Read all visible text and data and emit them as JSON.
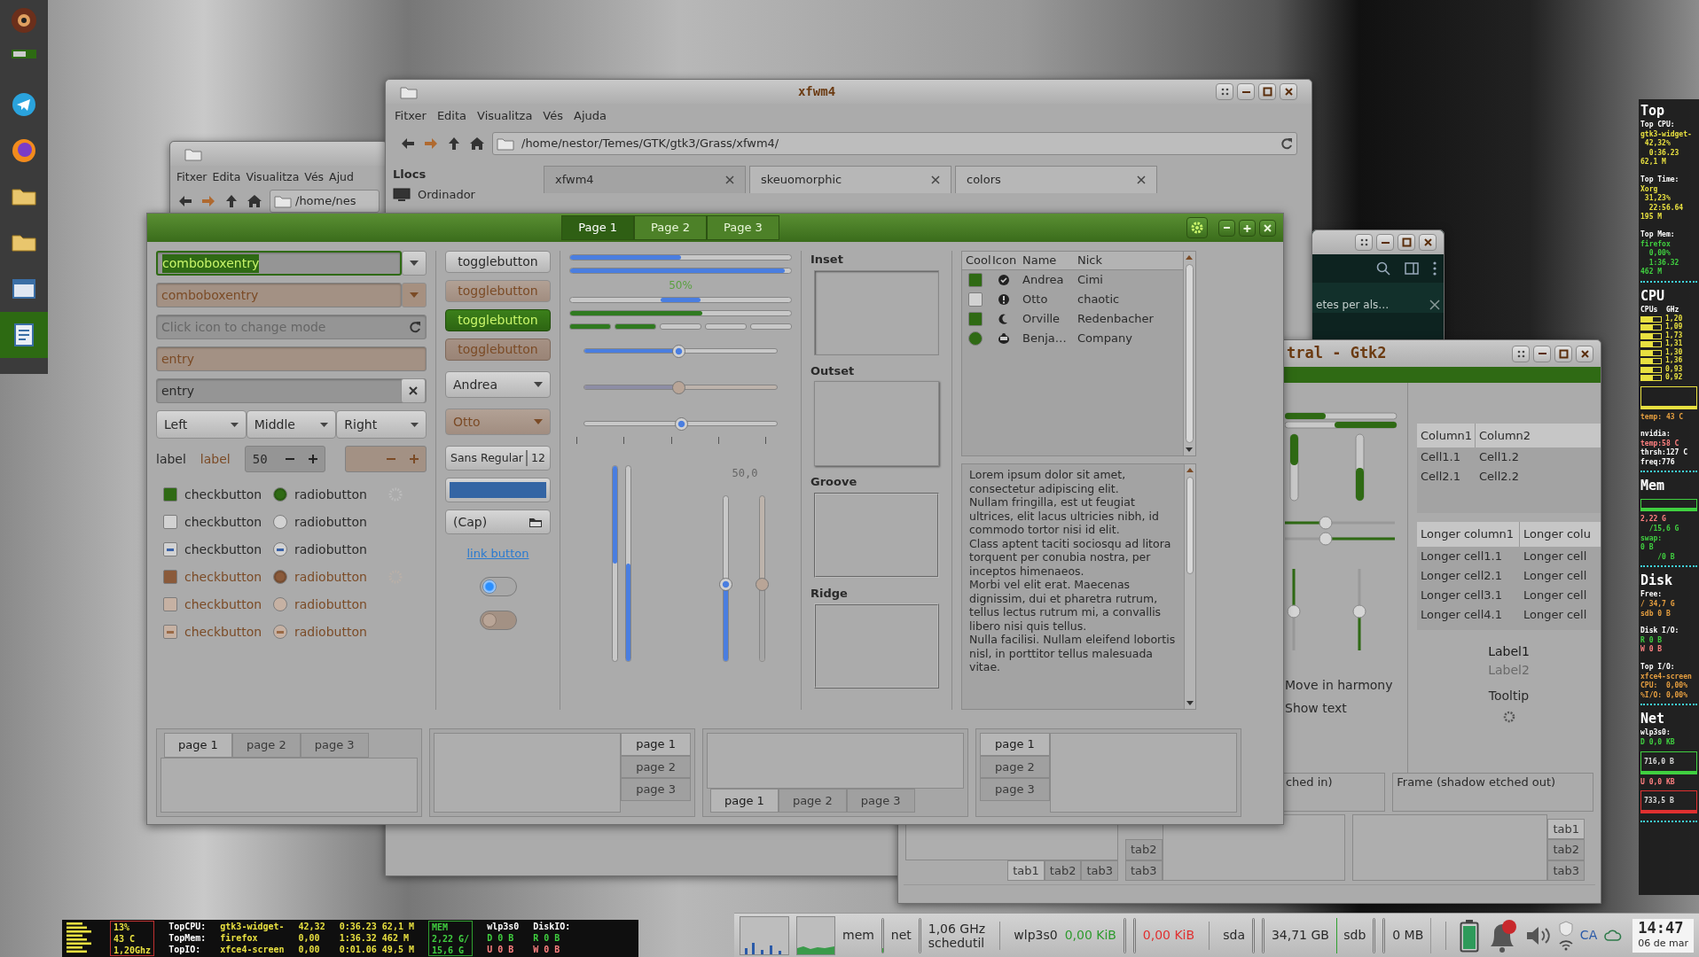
{
  "dock": {
    "items": [
      {
        "selected": false
      },
      {
        "selected": false
      },
      {
        "selected": false
      },
      {
        "selected": false
      },
      {
        "selected": false
      },
      {
        "selected": true
      }
    ]
  },
  "file_manager_back": {
    "menu": [
      "Fitxer",
      "Edita",
      "Visualitza",
      "Vés",
      "Ajud"
    ],
    "path": "/home/nes"
  },
  "file_manager": {
    "title": "xfwm4",
    "menu": [
      "Fitxer",
      "Edita",
      "Visualitza",
      "Vés",
      "Ajuda"
    ],
    "path": "/home/nestor/Temes/GTK/gtk3/Grass/xfwm4/",
    "sidebar": {
      "heading": "Llocs",
      "items": [
        "Ordinador"
      ]
    },
    "tabs": [
      {
        "label": "xfwm4",
        "selected": true
      },
      {
        "label": "skeuomorphic",
        "selected": false
      },
      {
        "label": "colors",
        "selected": false
      }
    ]
  },
  "dark_window": {
    "text": "etes per als…"
  },
  "gtk2_window": {
    "title": "tral - Gtk2",
    "options": [
      "Move in harmony",
      "Show text"
    ],
    "table1": {
      "columns": [
        "Column1",
        "Column2"
      ],
      "rows": [
        [
          "Cell1.1",
          "Cell1.2"
        ],
        [
          "Cell2.1",
          "Cell2.2"
        ]
      ]
    },
    "table2": {
      "columns": [
        "Longer column1",
        "Longer colu"
      ],
      "rows": [
        [
          "Longer cell1.1",
          "Longer cell"
        ],
        [
          "Longer cell2.1",
          "Longer cell"
        ],
        [
          "Longer cell3.1",
          "Longer cell"
        ],
        [
          "Longer cell4.1",
          "Longer cell"
        ]
      ]
    },
    "labels": [
      {
        "text": "Label1",
        "disabled": false
      },
      {
        "text": "Label2",
        "disabled": true
      }
    ],
    "tooltip": "Tooltip",
    "frames": [
      "ched in)",
      "Frame (shadow etched out)"
    ],
    "notebooks": [
      {
        "kind": "bottom",
        "tabs": [
          {
            "label": "tab1",
            "selected": true
          },
          {
            "label": "tab2",
            "selected": false
          },
          {
            "label": "tab3",
            "selected": false
          }
        ]
      },
      {
        "kind": "left",
        "tabs": [
          {
            "label": "tab2",
            "selected": false
          },
          {
            "label": "tab3",
            "selected": false
          }
        ]
      },
      {
        "kind": "right",
        "tabs": [
          {
            "label": "tab1",
            "selected": true
          },
          {
            "label": "tab2",
            "selected": false
          },
          {
            "label": "tab3",
            "selected": false
          }
        ]
      }
    ]
  },
  "widget_factory": {
    "tabs": [
      {
        "label": "Page 1",
        "selected": true
      },
      {
        "label": "Page 2",
        "selected": false
      },
      {
        "label": "Page 3",
        "selected": false
      }
    ],
    "combos": [
      {
        "value": "comboboxentry",
        "focused": true,
        "disabled": false
      },
      {
        "value": "comboboxentry",
        "focused": false,
        "disabled": true
      }
    ],
    "entries": [
      {
        "kind": "mode",
        "placeholder": "Click icon to change mode",
        "disabled": false
      },
      {
        "kind": "plain",
        "value": "entry",
        "disabled": true
      },
      {
        "kind": "clear",
        "value": "entry",
        "disabled": false
      }
    ],
    "dropdowns": [
      "Left",
      "Middle",
      "Right"
    ],
    "labels": [
      {
        "text": "label",
        "disabled": false
      },
      {
        "text": "label",
        "disabled": true
      }
    ],
    "spins": [
      {
        "value": "50",
        "disabled": false
      },
      {
        "disabled": true
      }
    ],
    "checks": [
      {
        "kind": "check",
        "label": "checkbutton",
        "checked": true,
        "disabled": false,
        "spinner": true
      },
      {
        "kind": "check",
        "label": "checkbutton",
        "checked": false,
        "disabled": false,
        "spinner": false
      },
      {
        "kind": "mixed",
        "label": "checkbutton",
        "disabled": false,
        "spinner": false
      },
      {
        "kind": "check",
        "label": "checkbutton",
        "checked": true,
        "disabled": true,
        "spinner": true
      },
      {
        "kind": "check",
        "label": "checkbutton",
        "checked": false,
        "disabled": true,
        "spinner": false
      },
      {
        "kind": "mixed",
        "label": "checkbutton",
        "disabled": true,
        "spinner": false
      }
    ],
    "radios": [
      {
        "kind": "radio",
        "label": "radiobutton",
        "selected": true,
        "disabled": false
      },
      {
        "kind": "radio",
        "label": "radiobutton",
        "selected": false,
        "disabled": false
      },
      {
        "kind": "mixed",
        "label": "radiobutton",
        "disabled": false
      },
      {
        "kind": "radio",
        "label": "radiobutton",
        "selected": true,
        "disabled": true
      },
      {
        "kind": "radio",
        "label": "radiobutton",
        "selected": false,
        "disabled": true
      },
      {
        "kind": "mixed",
        "label": "radiobutton",
        "disabled": true
      }
    ],
    "toggles": [
      {
        "label": "togglebutton",
        "active": false,
        "disabled": false
      },
      {
        "label": "togglebutton",
        "active": false,
        "disabled": true
      },
      {
        "label": "togglebutton",
        "active": true,
        "disabled": false
      },
      {
        "label": "togglebutton",
        "active": true,
        "disabled": true
      }
    ],
    "name_combos": [
      {
        "value": "Andrea",
        "disabled": false
      },
      {
        "value": "Otto",
        "disabled": true
      }
    ],
    "font_button": {
      "family": "Sans Regular",
      "size": "12"
    },
    "color_button": {
      "color": "#3465a4"
    },
    "file_button": {
      "label": "(Cap)"
    },
    "link_button": "link button",
    "switches": [
      {
        "on": false,
        "disabled": false
      },
      {
        "on": false,
        "disabled": true
      }
    ],
    "progress": [
      {
        "kind": "progress",
        "level": 0.5
      },
      {
        "kind": "progress",
        "level": 0.97
      },
      {
        "kind": "label",
        "text": "50%"
      },
      {
        "kind": "pulse"
      },
      {
        "kind": "level",
        "level": 0.6
      },
      {
        "kind": "segments",
        "level": 0.4
      }
    ],
    "scales": [
      {
        "level": 0.49,
        "disabled": false,
        "marks": false
      },
      {
        "level": 0.49,
        "disabled": true,
        "marks": false
      },
      {
        "level": 0.5,
        "disabled": false,
        "marks": true
      }
    ],
    "vprogress": [
      {
        "level": 0.5,
        "inverted": false
      },
      {
        "level": 0.5,
        "inverted": true
      }
    ],
    "vscale_label": "50,0",
    "vscales": [
      {
        "level": 0.47,
        "disabled": false
      },
      {
        "level": 0.47,
        "disabled": true
      }
    ],
    "frames": [
      "Inset",
      "Outset",
      "Groove",
      "Ridge"
    ],
    "tree": {
      "columns": [
        "Cool",
        "Icon",
        "Name",
        "Nick"
      ],
      "rows": [
        {
          "kind": "check",
          "checked": true,
          "name": "Andrea",
          "nick": "Cimi"
        },
        {
          "kind": "check",
          "checked": false,
          "name": "Otto",
          "nick": "chaotic"
        },
        {
          "kind": "check",
          "checked": true,
          "name": "Orville",
          "nick": "Redenbacher"
        },
        {
          "kind": "radio",
          "checked": true,
          "name": "Benja…",
          "nick": "Company"
        }
      ]
    },
    "text": [
      "Lorem ipsum dolor sit amet, consectetur adipiscing elit.",
      "Nullam fringilla, est ut feugiat ultrices, elit lacus ultricies nibh, id commodo tortor nisi id elit.",
      "Class aptent taciti sociosqu ad litora torquent per conubia nostra, per inceptos himenaeos.",
      "Morbi vel elit erat. Maecenas dignissim, dui et pharetra rutrum, tellus lectus rutrum mi, a convallis libero nisi quis tellus.",
      "Nulla facilisi. Nullam eleifend lobortis nisl, in porttitor tellus malesuada vitae."
    ],
    "notebooks": [
      {
        "kind": "top",
        "tabs": [
          {
            "label": "page 1",
            "selected": true
          },
          {
            "label": "page 2",
            "selected": false
          },
          {
            "label": "page 3",
            "selected": false
          }
        ]
      },
      {
        "kind": "right",
        "tabs": [
          {
            "label": "page 1",
            "selected": true
          },
          {
            "label": "page 2",
            "selected": false
          },
          {
            "label": "page 3",
            "selected": false
          }
        ]
      },
      {
        "kind": "bottom",
        "tabs": [
          {
            "label": "page 1",
            "selected": true
          },
          {
            "label": "page 2",
            "selected": false
          },
          {
            "label": "page 3",
            "selected": false
          }
        ]
      },
      {
        "kind": "left",
        "tabs": [
          {
            "label": "page 1",
            "selected": true
          },
          {
            "label": "page 2",
            "selected": false
          },
          {
            "label": "page 3",
            "selected": false
          }
        ]
      }
    ]
  },
  "conky_side": {
    "sections": [
      {
        "title": "Top",
        "items": [
          {
            "kind": "text",
            "text": "Top CPU:",
            "color": "#ffffff"
          },
          {
            "kind": "text",
            "text": "gtk3-widget-",
            "color": "#e8e040"
          },
          {
            "kind": "text",
            "text": " 42,32%",
            "color": "#e8e040"
          },
          {
            "kind": "text",
            "text": "  0:36.23",
            "color": "#e8e040"
          },
          {
            "kind": "text",
            "text": "62,1 M",
            "color": "#e8e040"
          },
          {
            "kind": "gap"
          },
          {
            "kind": "text",
            "text": "Top Time:",
            "color": "#ffffff"
          },
          {
            "kind": "text",
            "text": "Xorg",
            "color": "#e8e040"
          },
          {
            "kind": "text",
            "text": " 31,23%",
            "color": "#e8e040"
          },
          {
            "kind": "text",
            "text": "  22:56.64",
            "color": "#e8e040"
          },
          {
            "kind": "text",
            "text": "195 M",
            "color": "#e8e040"
          },
          {
            "kind": "gap"
          },
          {
            "kind": "text",
            "text": "Top Mem:",
            "color": "#ffffff"
          },
          {
            "kind": "text",
            "text": "firefox",
            "color": "#40d040"
          },
          {
            "kind": "text",
            "text": "  0,00%",
            "color": "#40d040"
          },
          {
            "kind": "text",
            "text": "  1:36.32",
            "color": "#40d040"
          },
          {
            "kind": "text",
            "text": "462 M",
            "color": "#40d040"
          }
        ]
      },
      {
        "title": "CPU",
        "items": [
          {
            "kind": "text",
            "text": "CPUs  GHz",
            "color": "#ffffff"
          },
          {
            "kind": "cpu",
            "values": [
              "1,20",
              "1,09",
              "1,73",
              "1,31",
              "1,30",
              "1,36",
              "0,93",
              "0,92"
            ]
          },
          {
            "kind": "graph",
            "color": "#e8e040"
          },
          {
            "kind": "text",
            "text": "temp: 43 C",
            "color": "#e8a040"
          },
          {
            "kind": "gap"
          },
          {
            "kind": "text",
            "text": "nvidia:",
            "color": "#ffffff"
          },
          {
            "kind": "text",
            "text": "temp:58 C",
            "color": "#ff8080"
          },
          {
            "kind": "text",
            "text": "thrsh:127 C",
            "color": "#ffffff"
          },
          {
            "kind": "text",
            "text": "freq:776",
            "color": "#ffffff"
          }
        ]
      },
      {
        "title": "Mem",
        "items": [
          {
            "kind": "meter",
            "color": "#40d040"
          },
          {
            "kind": "text",
            "text": "2,22 G",
            "color": "#ff8080"
          },
          {
            "kind": "text",
            "text": "  /15,6 G",
            "color": "#40d040"
          },
          {
            "kind": "text",
            "text": "swap:",
            "color": "#40d040"
          },
          {
            "kind": "text",
            "text": "0 B",
            "color": "#40d040"
          },
          {
            "kind": "text",
            "text": "    /0 B",
            "color": "#40d040"
          }
        ]
      },
      {
        "title": "Disk",
        "items": [
          {
            "kind": "text",
            "text": "Free:",
            "color": "#ffffff"
          },
          {
            "kind": "text",
            "text": "/ 34,7 G",
            "color": "#e8a040"
          },
          {
            "kind": "text",
            "text": "sdb 0 B",
            "color": "#e8a040"
          },
          {
            "kind": "gap"
          },
          {
            "kind": "text",
            "text": "Disk I/O:",
            "color": "#ffffff"
          },
          {
            "kind": "text",
            "text": "R 0 B",
            "color": "#40d040"
          },
          {
            "kind": "text",
            "text": "W 0 B",
            "color": "#ff8080"
          },
          {
            "kind": "gap"
          },
          {
            "kind": "text",
            "text": "Top I/O:",
            "color": "#ffffff"
          },
          {
            "kind": "text",
            "text": "xfce4-screen",
            "color": "#e8a040"
          },
          {
            "kind": "text",
            "text": "CPU:  0,00%",
            "color": "#e8a040"
          },
          {
            "kind": "text",
            "text": "%I/O: 0,00%",
            "color": "#e8a040"
          }
        ]
      },
      {
        "title": "Net",
        "items": [
          {
            "kind": "text",
            "text": "wlp3s0:",
            "color": "#ffffff"
          },
          {
            "kind": "text",
            "text": "D 0,0 KB",
            "color": "#40d040"
          },
          {
            "kind": "graph",
            "color": "#40d040",
            "text": "716,0 B"
          },
          {
            "kind": "text",
            "text": "U 0,0 KB",
            "color": "#ff8080"
          },
          {
            "kind": "graph",
            "color": "#e03030",
            "text": "733,5 B"
          }
        ]
      }
    ]
  },
  "conky_bottom": {
    "columns": [
      {
        "kind": "cpu-bars"
      },
      {
        "kind": "box",
        "color": "#c03030",
        "lines": [
          {
            "text": "13%",
            "color": "#e8e040"
          },
          {
            "text": "43 C",
            "color": "#e8e040"
          },
          {
            "text": "1,20Ghz",
            "color": "#e8e040"
          }
        ]
      },
      {
        "kind": "text",
        "lines": [
          {
            "text": "TopCPU:",
            "color": "#ffffff"
          },
          {
            "text": "TopMem:",
            "color": "#ffffff"
          },
          {
            "text": "TopIO:",
            "color": "#ffffff"
          }
        ]
      },
      {
        "kind": "text",
        "lines": [
          {
            "text": "gtk3-widget-",
            "color": "#e8e040"
          },
          {
            "text": "firefox",
            "color": "#e8e040"
          },
          {
            "text": "xfce4-screen",
            "color": "#e8e040"
          }
        ]
      },
      {
        "kind": "text",
        "lines": [
          {
            "text": "42,32",
            "color": "#e8e040"
          },
          {
            "text": "0,00",
            "color": "#e8e040"
          },
          {
            "text": "0,00",
            "color": "#e8e040"
          }
        ]
      },
      {
        "kind": "text",
        "lines": [
          {
            "text": "0:36.23 62,1 M",
            "color": "#e8e040"
          },
          {
            "text": "1:36.32 462 M",
            "color": "#e8e040"
          },
          {
            "text": "0:01.06 49,5 M",
            "color": "#e8e040"
          }
        ]
      },
      {
        "kind": "box",
        "color": "#30a030",
        "lines": [
          {
            "text": "MEM",
            "color": "#40d040"
          },
          {
            "text": "2,22 G/",
            "color": "#40d040"
          },
          {
            "text": "15,6 G",
            "color": "#40d040"
          }
        ]
      },
      {
        "kind": "text",
        "lines": [
          {
            "text": "wlp3s0",
            "color": "#ffffff"
          },
          {
            "text": "D 0 B",
            "color": "#40d040"
          },
          {
            "text": "U 0 B",
            "color": "#ff8080"
          }
        ]
      },
      {
        "kind": "text",
        "lines": [
          {
            "text": "DiskIO:",
            "color": "#ffffff"
          },
          {
            "text": "R 0 B",
            "color": "#40d040"
          },
          {
            "text": "W 0 B",
            "color": "#ff8080"
          }
        ]
      }
    ]
  },
  "panel": {
    "items": [
      {
        "kind": "cpu-graph"
      },
      {
        "kind": "net-graph"
      },
      {
        "kind": "label",
        "text": "mem"
      },
      {
        "kind": "meter",
        "level": 0.12
      },
      {
        "kind": "label",
        "text": "net"
      },
      {
        "kind": "meter",
        "level": 0
      },
      {
        "kind": "stack",
        "lines": [
          "1,06 GHz",
          "schedutil"
        ]
      },
      {
        "kind": "sep"
      },
      {
        "kind": "label",
        "text": "wlp3s0"
      },
      {
        "kind": "label",
        "text": "0,00 KiB",
        "color": "#2e9a2e"
      },
      {
        "kind": "meter",
        "level": 0
      },
      {
        "kind": "meter",
        "level": 0
      },
      {
        "kind": "label",
        "text": "0,00 KiB",
        "color": "#e03030"
      },
      {
        "kind": "sep"
      },
      {
        "kind": "label",
        "text": "sda"
      },
      {
        "kind": "meter",
        "level": 0
      },
      {
        "kind": "meter",
        "level": 0
      },
      {
        "kind": "label",
        "text": "34,71 GB"
      },
      {
        "kind": "bar",
        "level": 1
      },
      {
        "kind": "label",
        "text": "sdb"
      },
      {
        "kind": "meter",
        "level": 0
      },
      {
        "kind": "meter",
        "level": 0
      },
      {
        "kind": "label",
        "text": "0 MB"
      },
      {
        "kind": "bar",
        "level": 0
      },
      {
        "kind": "sep"
      },
      {
        "kind": "battery"
      },
      {
        "kind": "bell"
      },
      {
        "kind": "volume"
      },
      {
        "kind": "tray"
      },
      {
        "kind": "label",
        "text": "CA",
        "color": "#2a5aa8"
      },
      {
        "kind": "cloud"
      },
      {
        "kind": "clock",
        "time": "14:47",
        "date": "06 de mar"
      }
    ]
  }
}
